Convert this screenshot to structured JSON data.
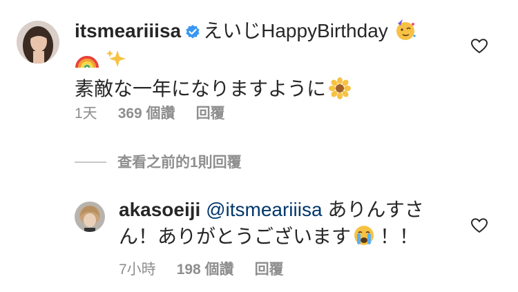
{
  "comment1": {
    "username": "itsmeariiisa",
    "text_line1": "えいじHappyBirthday",
    "text_line3": "素敵な一年になりますように",
    "time": "1天",
    "likes": "369 個讚",
    "reply": "回覆"
  },
  "view_more": "查看之前的1則回覆",
  "comment2": {
    "username": "akasoeiji",
    "mention": "@itsmeariiisa",
    "text_part1": "ありんすさ",
    "text_line2": "ん！ありがとうございます",
    "text_end": "！！",
    "time": "7小時",
    "likes": "198 個讚",
    "reply": "回覆"
  },
  "icons": [
    "verified-badge-icon",
    "party-face-emoji",
    "rainbow-emoji",
    "sparkles-emoji",
    "sunflower-emoji",
    "crying-face-emoji",
    "heart-icon"
  ]
}
